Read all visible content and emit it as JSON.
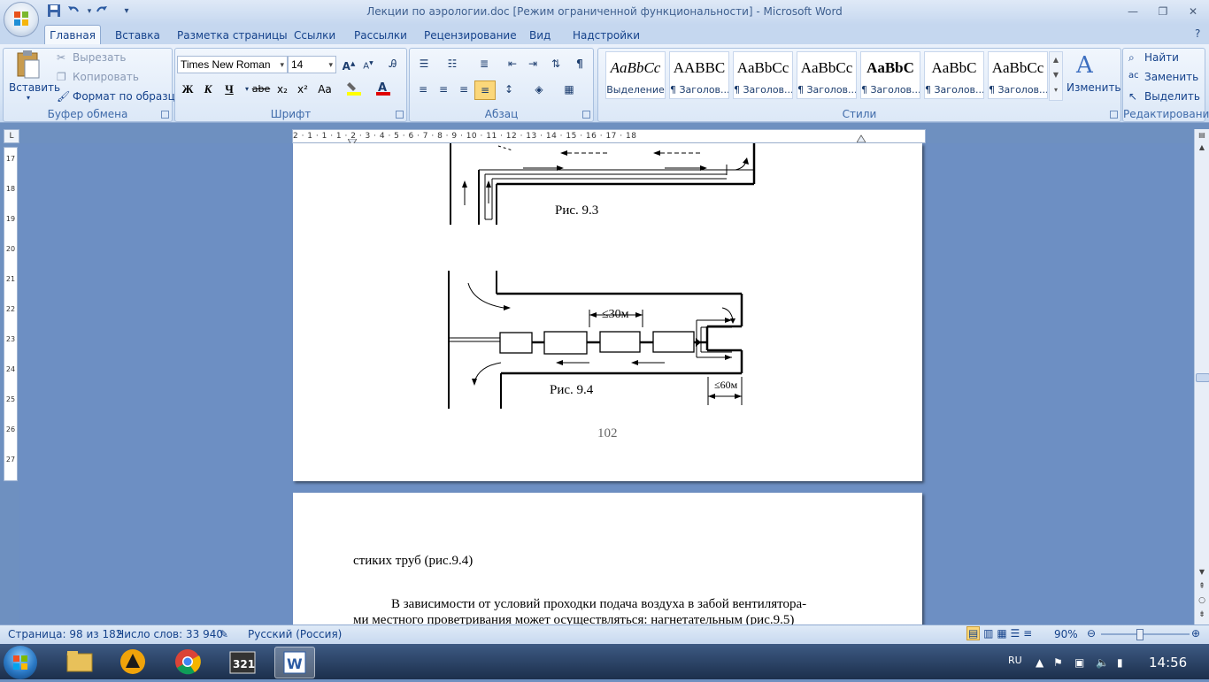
{
  "window": {
    "title": "Лекции по аэрологии.doc [Режим ограниченной функциональности] - Microsoft Word",
    "min_icon": "minimize-icon",
    "max_icon": "restore-icon",
    "close_icon": "close-icon"
  },
  "qat": {
    "save_icon": "save-icon",
    "undo_icon": "undo-icon",
    "redo_icon": "redo-icon",
    "customize_icon": "chevron-down-icon"
  },
  "tabs": [
    {
      "label": "Главная"
    },
    {
      "label": "Вставка"
    },
    {
      "label": "Разметка страницы"
    },
    {
      "label": "Ссылки"
    },
    {
      "label": "Рассылки"
    },
    {
      "label": "Рецензирование"
    },
    {
      "label": "Вид"
    },
    {
      "label": "Надстройки"
    }
  ],
  "clipboard": {
    "paste": "Вставить",
    "cut": "Вырезать",
    "copy": "Копировать",
    "format_painter": "Формат по образцу",
    "group": "Буфер обмена"
  },
  "font": {
    "name": "Times New Roman",
    "size": "14",
    "group": "Шрифт",
    "bold": "Ж",
    "italic": "К",
    "underline": "Ч",
    "strike": "abe",
    "sub": "x₂",
    "sup": "x²",
    "case": "Aa",
    "grow": "A",
    "shrink": "A"
  },
  "paragraph": {
    "group": "Абзац",
    "pilcrow": "¶"
  },
  "styles": {
    "group": "Стили",
    "change": "Изменить стили",
    "items": [
      {
        "sample": "AaBbCc",
        "name": "Выделение"
      },
      {
        "sample": "AABBC",
        "name": "¶ Заголов..."
      },
      {
        "sample": "AaBbCc",
        "name": "¶ Заголов..."
      },
      {
        "sample": "AaBbCc",
        "name": "¶ Заголов..."
      },
      {
        "sample": "AaBbC",
        "name": "¶ Заголов..."
      },
      {
        "sample": "AaBbC",
        "name": "¶ Заголов..."
      },
      {
        "sample": "AaBbCc",
        "name": "¶ Заголов..."
      }
    ]
  },
  "editing": {
    "find": "Найти",
    "replace": "Заменить",
    "select": "Выделить",
    "group": "Редактирование"
  },
  "ruler": {
    "h_labels": "2 · 1 · 1 · 1 · 2 · 3 · 4 · 5 · 6 · 7 · 8 · 9 · 10 · 11 · 12 · 13 · 14 · 15 · 16 · 17 · 18",
    "v_labels": [
      "17",
      "18",
      "19",
      "20",
      "21",
      "22",
      "23",
      "24",
      "25",
      "26",
      "27"
    ],
    "toggle": "L"
  },
  "document": {
    "fig93_caption": "Рис. 9.3",
    "fig94_caption": "Рис. 9.4",
    "fig94_dim1": "≤30м",
    "fig94_dim2": "≤60м",
    "page_number": "102",
    "p2_line1": "стиких труб (рис.9.4)",
    "p2_line2": "В зависимости от условий проходки подача воздуха в забой вентилятора-",
    "p2_line3": "ми местного проветривания может осуществляться: нагнетательным (рис.9.5)"
  },
  "status": {
    "page": "Страница: 98 из 182",
    "words": "Число слов: 33 940",
    "lang": "Русский (Россия)",
    "zoom": "90%"
  },
  "taskbar": {
    "lang": "RU",
    "time": "14:56"
  }
}
